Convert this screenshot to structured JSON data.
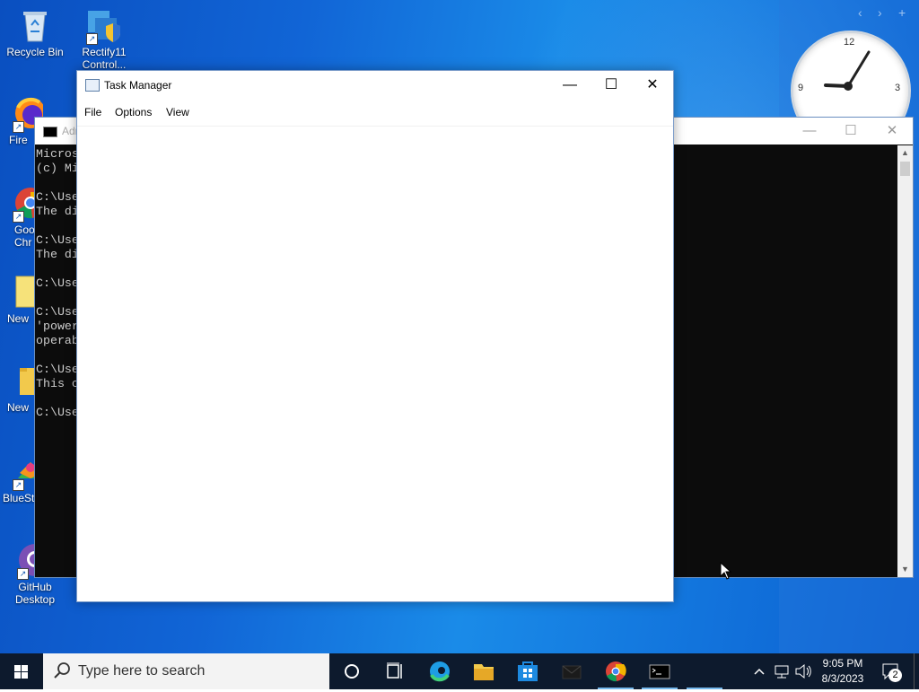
{
  "desktop": {
    "icons": [
      {
        "label": "Recycle Bin"
      },
      {
        "label": "Rectify11 Control..."
      },
      {
        "label": "Fire"
      },
      {
        "label": "Goo Chr"
      },
      {
        "label": "New"
      },
      {
        "label": "New"
      },
      {
        "label": "BlueSt"
      },
      {
        "label": "GitHub Desktop"
      }
    ],
    "clock": {
      "n12": "12",
      "n3": "3",
      "n9": "9"
    }
  },
  "cmd_window": {
    "title": "Adr",
    "minimize": "—",
    "maximize": "☐",
    "close": "✕",
    "lines": [
      "Micros",
      "(c) Mi",
      "",
      "C:\\Use",
      "The di",
      "",
      "C:\\Use",
      "The di",
      "",
      "C:\\Use",
      "",
      "C:\\Use",
      "'power",
      "operab",
      "",
      "C:\\Use",
      "This c",
      "",
      "C:\\Use"
    ]
  },
  "task_manager": {
    "title": "Task Manager",
    "minimize": "—",
    "maximize": "☐",
    "close": "✕",
    "menu": {
      "file": "File",
      "options": "Options",
      "view": "View"
    }
  },
  "taskbar": {
    "search_placeholder": "Type here to search",
    "time": "9:05 PM",
    "date": "8/3/2023",
    "notification_count": "2"
  },
  "colors": {
    "desktop_blue": "#1165d6",
    "taskbar": "#0d1a2d",
    "active_indicator": "#76b9ed"
  }
}
